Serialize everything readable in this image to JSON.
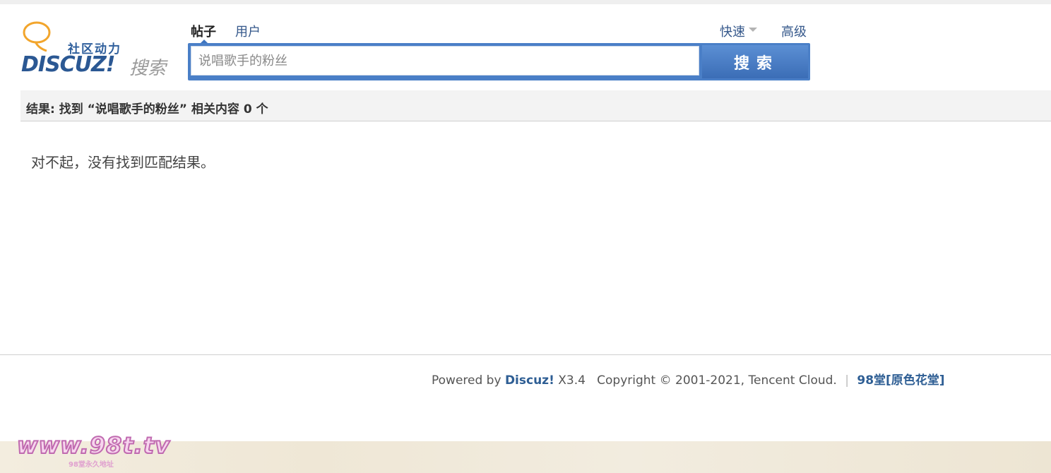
{
  "logo": {
    "cn_text": "社区动力",
    "brand": "DISCUZ!",
    "suffix": "搜索"
  },
  "tabs": [
    {
      "label": "帖子",
      "active": true
    },
    {
      "label": "用户",
      "active": false
    }
  ],
  "quick_label": "快速",
  "advanced_label": "高级",
  "search": {
    "placeholder": "说唱歌手的粉丝",
    "button_label": "搜索"
  },
  "result": {
    "summary": "结果: 找到 “说唱歌手的粉丝” 相关内容 0 个",
    "empty_message": "对不起，没有找到匹配结果。"
  },
  "footer": {
    "powered_prefix": "Powered by",
    "powered_brand": "Discuz!",
    "version": "X3.4",
    "copyright": "Copyright © 2001-2021, Tencent Cloud.",
    "separator": "|",
    "site_name": "98堂[原色花堂]"
  },
  "watermark": {
    "domain": "www.98t.tv",
    "subtitle": "98堂永久地址"
  },
  "colors": {
    "accent_blue": "#4a7fc7",
    "link_blue": "#35588b",
    "logo_orange": "#f2a52c"
  }
}
